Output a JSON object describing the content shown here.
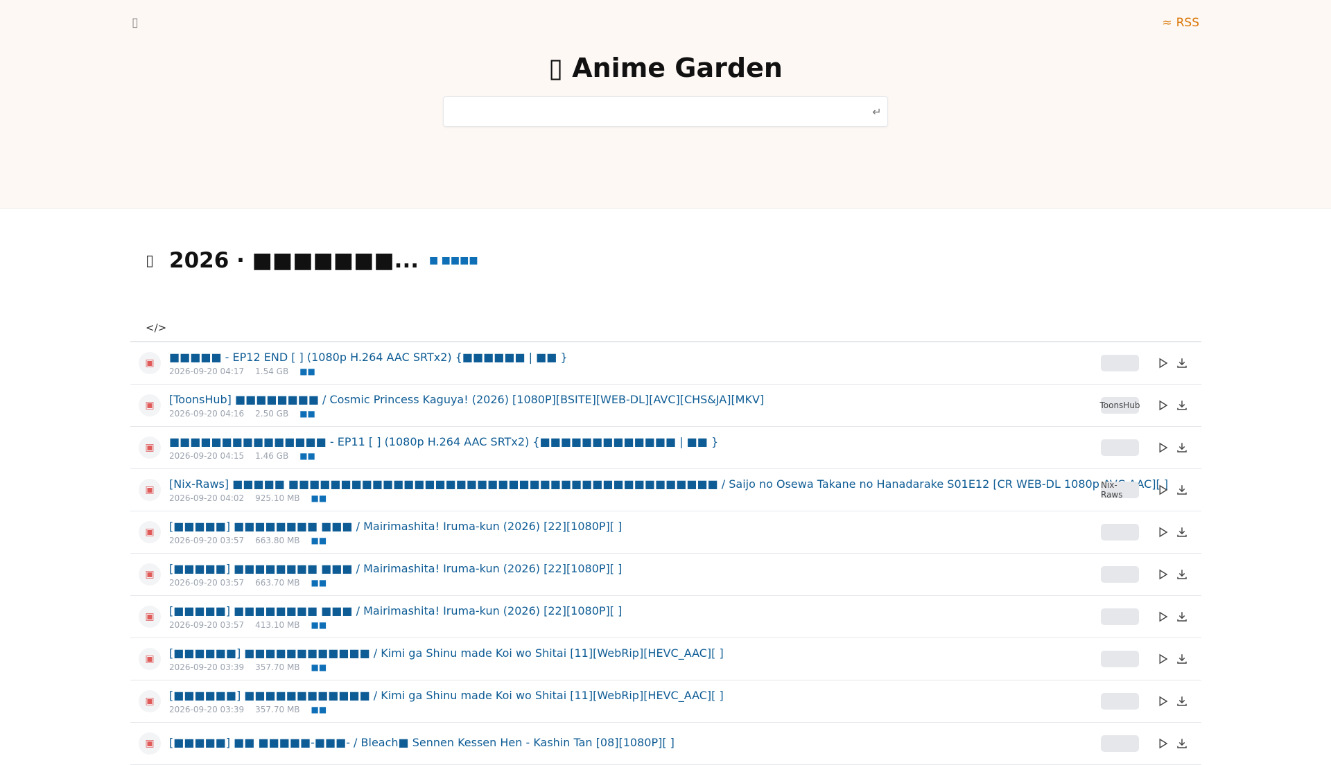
{
  "header": {
    "menu_icon": "menu-icon",
    "rss_label": "RSS",
    "brand": "Anime Garden",
    "search_placeholder": ""
  },
  "subject": {
    "title": "2026 · ■■■■■■■...",
    "link_label": "■ ■■■■"
  },
  "rows": [
    {
      "title": "■■■■■ - EP12 END [        ] (1080p H.264 AAC SRTx2) {■■■■■■ | ■■         }",
      "date": "2026-09-20 04:17",
      "size": "1.54 GB",
      "source": "■■",
      "fansub": ""
    },
    {
      "title": "[ToonsHub] ■■■■■■■■ / Cosmic Princess Kaguya! (2026) [1080P][BSITE][WEB-DL][AVC][CHS&JA][MKV]",
      "date": "2026-09-20 04:16",
      "size": "2.50 GB",
      "source": "■■",
      "fansub": "ToonsHub"
    },
    {
      "title": "■■■■■■■■■■■■■■■ - EP11 [        ] (1080p H.264 AAC SRTx2) {■■■■■■■■■■■■■ | ■■                            }",
      "date": "2026-09-20 04:15",
      "size": "1.46 GB",
      "source": "■■",
      "fansub": ""
    },
    {
      "title": "[Nix-Raws] ■■■■■ ■■■■■■■■■■■■■■■■■■■■■■■■■■■■■■■■■■■■■■■■■ / Saijo no Osewa Takane no Hanadarake S01E12 [CR WEB-DL 1080p AVC AAC][          ]",
      "date": "2026-09-20 04:02",
      "size": "925.10 MB",
      "source": "■■",
      "fansub": "Nix-Raws"
    },
    {
      "title": "[■■■■■] ■■■■■■■■ ■■■ / Mairimashita! Iruma-kun (2026) [22][1080P][          ]",
      "date": "2026-09-20 03:57",
      "size": "663.80 MB",
      "source": "■■",
      "fansub": ""
    },
    {
      "title": "[■■■■■] ■■■■■■■■ ■■■ / Mairimashita! Iruma-kun (2026) [22][1080P][          ]",
      "date": "2026-09-20 03:57",
      "size": "663.70 MB",
      "source": "■■",
      "fansub": ""
    },
    {
      "title": "[■■■■■] ■■■■■■■■ ■■■ / Mairimashita! Iruma-kun (2026) [22][1080P][          ]",
      "date": "2026-09-20 03:57",
      "size": "413.10 MB",
      "source": "■■",
      "fansub": ""
    },
    {
      "title": "[■■■■■■] ■■■■■■■■■■■■ / Kimi ga Shinu made Koi wo Shitai [11][WebRip][HEVC_AAC][          ]",
      "date": "2026-09-20 03:39",
      "size": "357.70 MB",
      "source": "■■",
      "fansub": ""
    },
    {
      "title": "[■■■■■■] ■■■■■■■■■■■■ / Kimi ga Shinu made Koi wo Shitai [11][WebRip][HEVC_AAC][          ]",
      "date": "2026-09-20 03:39",
      "size": "357.70 MB",
      "source": "■■",
      "fansub": ""
    },
    {
      "title": "[■■■■■] ■■ ■■■■■-■■■- / Bleach■ Sennen Kessen Hen - Kashin Tan [08][1080P][          ]",
      "date": "",
      "size": "",
      "source": "",
      "fansub": ""
    }
  ]
}
